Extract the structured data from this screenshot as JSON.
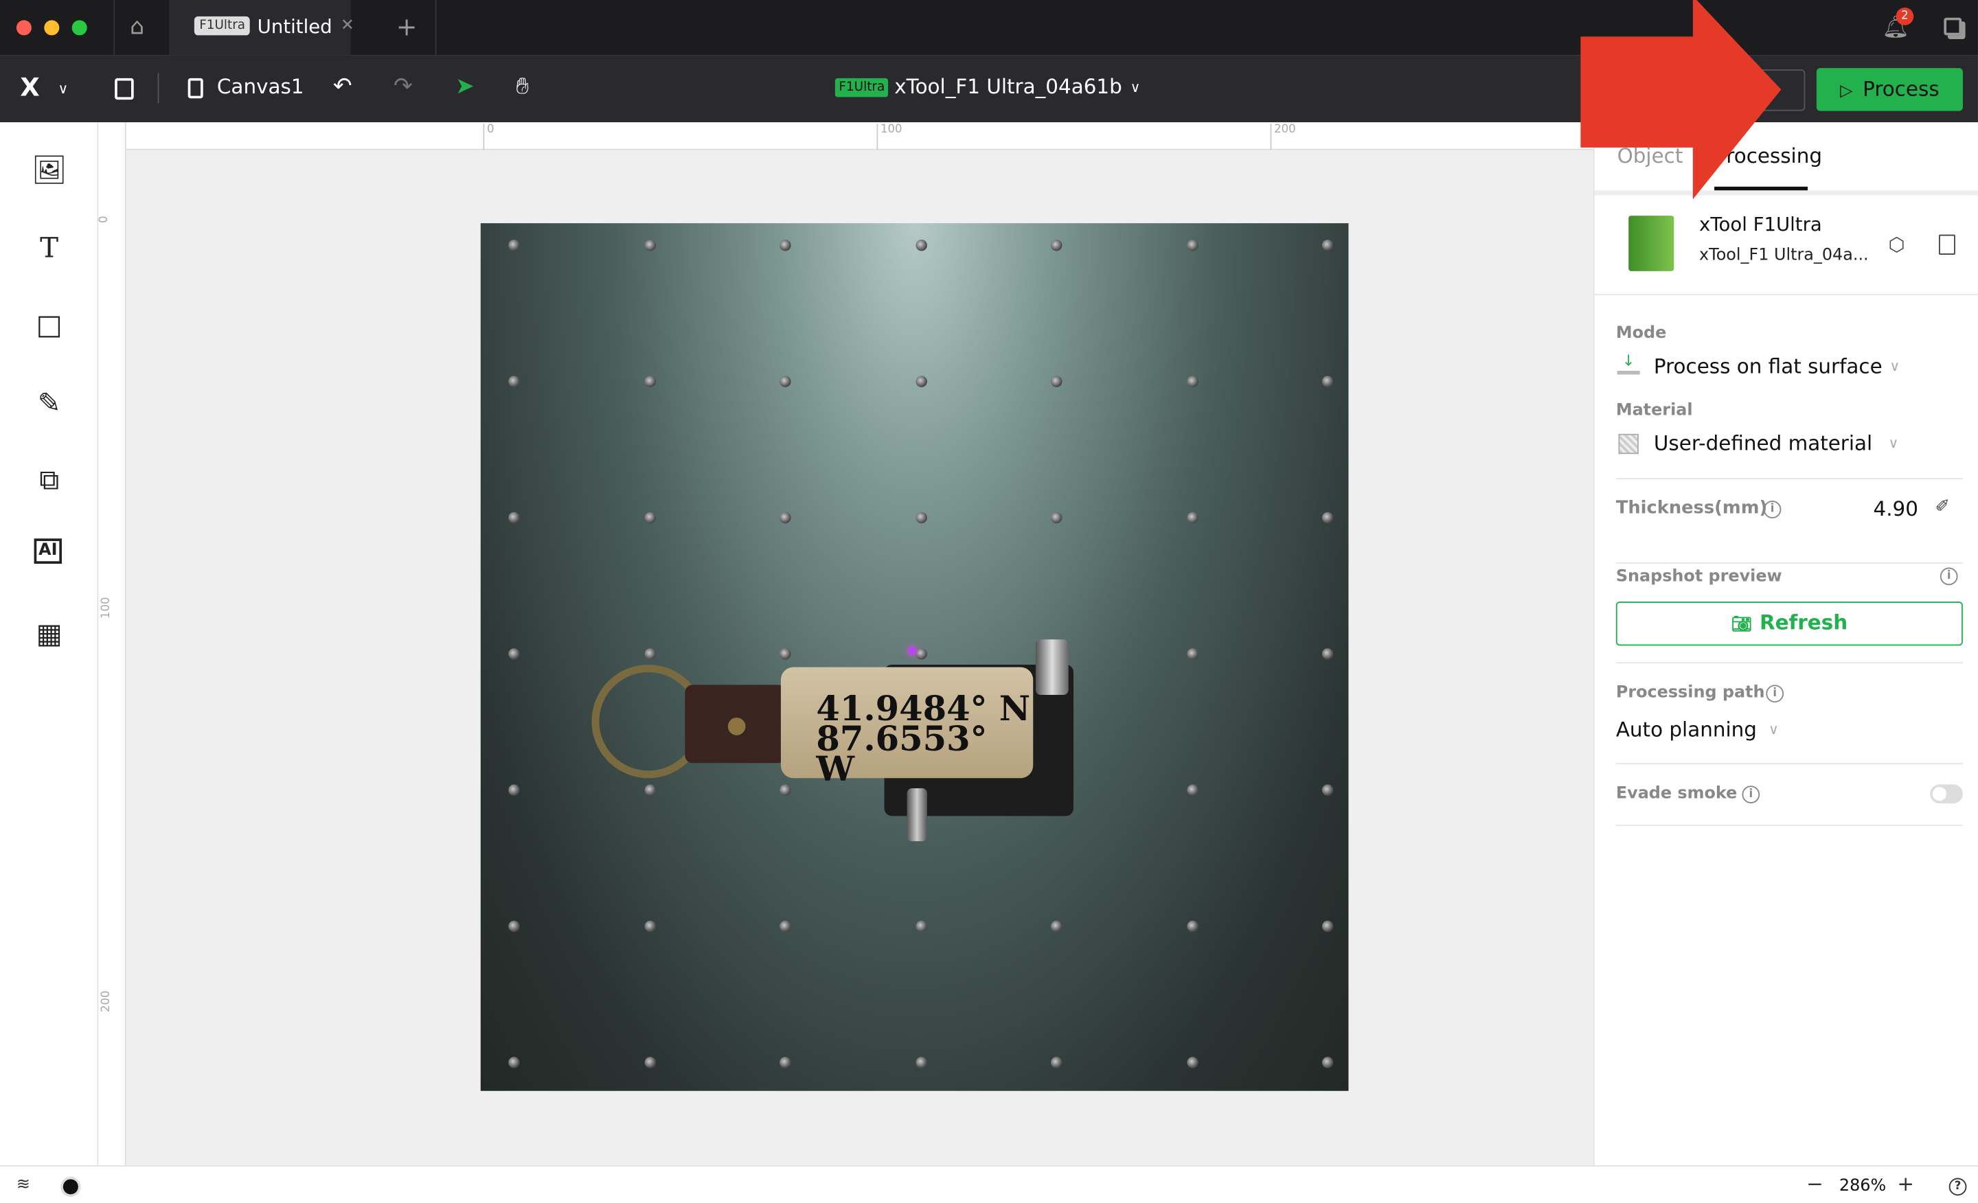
{
  "titlebar": {
    "tab_badge": "F1Ultra",
    "tab_title": "Untitled",
    "notification_count": "2"
  },
  "toolbar": {
    "canvas_name": "Canvas1",
    "device_badge": "F1Ultra",
    "device_name": "xTool_F1 Ultra_04a61b",
    "process_label": "Process"
  },
  "ruler": {
    "top": [
      "0",
      "100",
      "200"
    ],
    "left": [
      "0",
      "100",
      "200"
    ]
  },
  "photo": {
    "line1": "41.9484° N",
    "line2": "87.6553° W"
  },
  "panel": {
    "tabs": [
      {
        "label": "Object"
      },
      {
        "label": "Processing"
      }
    ],
    "device": {
      "model": "xTool F1Ultra",
      "name": "xTool_F1 Ultra_04a..."
    },
    "mode_label": "Mode",
    "mode_value": "Process on flat surface",
    "material_label": "Material",
    "material_value": "User-defined material",
    "thickness_label": "Thickness(mm)",
    "thickness_value": "4.90",
    "snapshot_label": "Snapshot preview",
    "refresh_label": "Refresh",
    "path_label": "Processing path",
    "path_value": "Auto planning",
    "smoke_label": "Evade smoke",
    "smoke_on": false
  },
  "bottom": {
    "zoom": "286%"
  },
  "colors": {
    "accent": "#22b14c",
    "annotation_arrow": "#e53a28"
  }
}
